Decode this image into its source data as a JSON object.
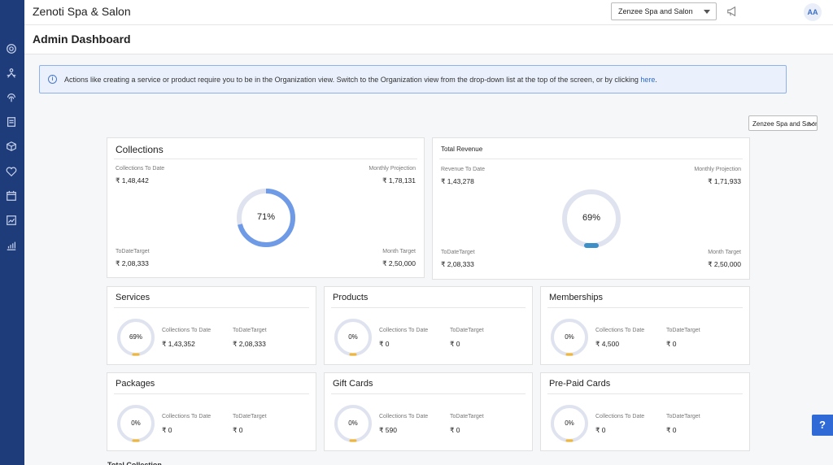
{
  "app": {
    "title": "Zenoti Spa & Salon"
  },
  "topbar": {
    "location": "Zenzee Spa and Salon",
    "avatar": "AA"
  },
  "page": {
    "title": "Admin Dashboard"
  },
  "banner": {
    "text": "Actions like creating a service or product require you to be in the Organization view. Switch to the Organization view from the drop-down list at the top of the screen, or by clicking ",
    "link": "here",
    "end": "."
  },
  "view_select": {
    "value": "Zenzee Spa and Salon"
  },
  "collections": {
    "title": "Collections",
    "to_date_label": "Collections To Date",
    "to_date": "₹ 1,48,442",
    "projection_label": "Monthly Projection",
    "projection": "₹ 1,78,131",
    "target_label": "ToDateTarget",
    "target": "₹ 2,08,333",
    "month_target_label": "Month Target",
    "month_target": "₹ 2,50,000",
    "percent_text": "71%",
    "percent": 71
  },
  "revenue": {
    "title": "Total Revenue",
    "to_date_label": "Revenue To Date",
    "to_date": "₹ 1,43,278",
    "projection_label": "Monthly Projection",
    "projection": "₹ 1,71,933",
    "target_label": "ToDateTarget",
    "target": "₹ 2,08,333",
    "month_target_label": "Month Target",
    "month_target": "₹ 2,50,000",
    "percent_text": "69%",
    "percent": 69
  },
  "categories": [
    {
      "title": "Services",
      "percent_text": "69%",
      "col_label": "Collections To Date",
      "col": "₹ 1,43,352",
      "tgt_label": "ToDateTarget",
      "tgt": "₹ 2,08,333"
    },
    {
      "title": "Products",
      "percent_text": "0%",
      "col_label": "Collections To Date",
      "col": "₹ 0",
      "tgt_label": "ToDateTarget",
      "tgt": "₹ 0"
    },
    {
      "title": "Memberships",
      "percent_text": "0%",
      "col_label": "Collections To Date",
      "col": "₹ 4,500",
      "tgt_label": "ToDateTarget",
      "tgt": "₹ 0"
    },
    {
      "title": "Packages",
      "percent_text": "0%",
      "col_label": "Collections To Date",
      "col": "₹ 0",
      "tgt_label": "ToDateTarget",
      "tgt": "₹ 0"
    },
    {
      "title": "Gift Cards",
      "percent_text": "0%",
      "col_label": "Collections To Date",
      "col": "₹ 590",
      "tgt_label": "ToDateTarget",
      "tgt": "₹ 0"
    },
    {
      "title": "Pre-Paid Cards",
      "percent_text": "0%",
      "col_label": "Collections To Date",
      "col": "₹ 0",
      "tgt_label": "ToDateTarget",
      "tgt": "₹ 0"
    }
  ],
  "help": {
    "label": "?"
  },
  "footer_peek": {
    "label": "Total Collection"
  },
  "colors": {
    "sidebar": "#1e3b7a",
    "accent": "#2f6ad6",
    "ring_track": "#dfe3ef",
    "ring_fill_collections": "#6f9ae6",
    "ring_fill_revenue": "#3d8fc7",
    "mini_marker": "#f2b632"
  }
}
